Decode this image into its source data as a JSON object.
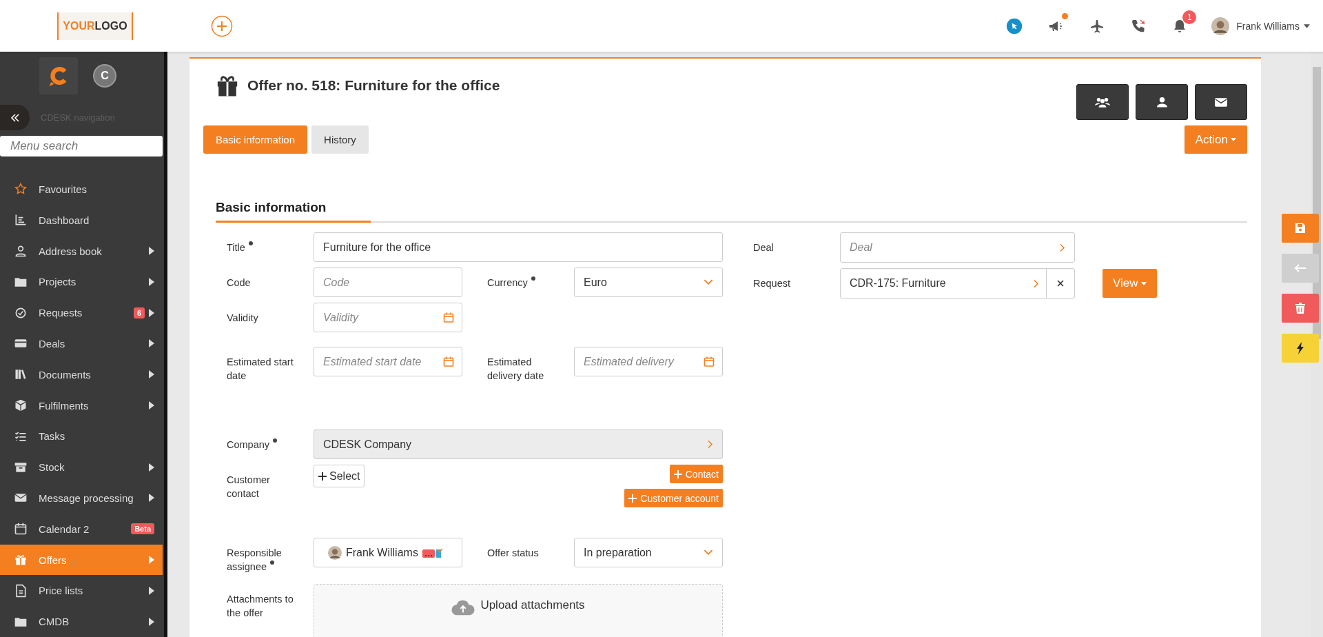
{
  "header": {
    "logo": [
      "YOUR",
      "LOGO"
    ],
    "announcement_unread": true,
    "notification_count": "1",
    "user_name": "Frank Williams"
  },
  "sidebar": {
    "app_initial": "C",
    "nav_label": "CDESK navigation",
    "search": {
      "placeholder": "Menu search"
    },
    "items": [
      {
        "label": "Favourites",
        "submenu": false,
        "selected": false
      },
      {
        "label": "Dashboard",
        "submenu": false,
        "selected": false
      },
      {
        "label": "Address book",
        "submenu": true,
        "selected": false
      },
      {
        "label": "Projects",
        "submenu": true,
        "selected": false
      },
      {
        "label": "Requests",
        "submenu": true,
        "selected": false,
        "badge": "6"
      },
      {
        "label": "Deals",
        "submenu": true,
        "selected": false
      },
      {
        "label": "Documents",
        "submenu": true,
        "selected": false
      },
      {
        "label": "Fulfilments",
        "submenu": true,
        "selected": false
      },
      {
        "label": "Tasks",
        "submenu": false,
        "selected": false
      },
      {
        "label": "Stock",
        "submenu": true,
        "selected": false
      },
      {
        "label": "Message processing",
        "submenu": true,
        "selected": false
      },
      {
        "label": "Calendar 2",
        "submenu": false,
        "selected": false,
        "badge": "Beta"
      },
      {
        "label": "Offers",
        "submenu": true,
        "selected": true
      },
      {
        "label": "Price lists",
        "submenu": true,
        "selected": false
      },
      {
        "label": "CMDB",
        "submenu": true,
        "selected": false
      }
    ]
  },
  "page": {
    "title": "Offer no. 518: Furniture for the office",
    "action_button": "Action",
    "tabs": [
      {
        "label": "Basic information",
        "selected": true
      },
      {
        "label": "History",
        "selected": false
      }
    ],
    "section_title": "Basic information",
    "rows": [
      {
        "fields": [
          {
            "kind": "text",
            "label": "Title",
            "required": true,
            "wide": true,
            "value": "Furniture for the office"
          }
        ]
      },
      {
        "fields": [
          {
            "kind": "text",
            "label": "Code",
            "required": false,
            "wide": false,
            "placeholder": "Code"
          },
          {
            "kind": "select",
            "label": "Currency",
            "required": true,
            "wide": false,
            "value": "Euro"
          }
        ]
      },
      {
        "fields": [
          {
            "kind": "date",
            "label": "Validity",
            "required": false,
            "wide": false,
            "placeholder": "Validity"
          }
        ]
      },
      {
        "fields": [
          {
            "kind": "date",
            "label": "Estimated start date",
            "required": false,
            "wide": false,
            "placeholder": "Estimated start date"
          },
          {
            "kind": "date",
            "label": "Estimated delivery date",
            "required": false,
            "wide": false,
            "placeholder": "Estimated delivery"
          }
        ]
      },
      {
        "fields": [
          {
            "kind": "lookup",
            "label": "Company",
            "required": true,
            "wide": true,
            "disabled": true,
            "value": "CDESK Company"
          }
        ]
      },
      {
        "fields": [
          {
            "kind": "contact",
            "label": "Customer contact",
            "required": false,
            "wide": true,
            "select_button": "Select",
            "buttons": [
              "Contact",
              "Customer account"
            ]
          }
        ]
      },
      {
        "fields": [
          {
            "kind": "user",
            "label": "Responsible assignee",
            "required": true,
            "wide": false,
            "value": "Frank Williams"
          },
          {
            "kind": "select",
            "label": "Offer status",
            "required": false,
            "wide": false,
            "value": "In preparation"
          }
        ]
      },
      {
        "fields": [
          {
            "kind": "upload",
            "label": "Attachments to the offer",
            "required": false,
            "wide": true,
            "value": "Upload attachments"
          }
        ]
      }
    ],
    "side_fields": [
      {
        "kind": "lookup",
        "label": "Deal",
        "placeholder": "Deal",
        "clearable": false
      },
      {
        "kind": "lookup",
        "label": "Request",
        "value": "CDR-175: Furniture",
        "clearable": true,
        "view_button": "View"
      }
    ]
  }
}
